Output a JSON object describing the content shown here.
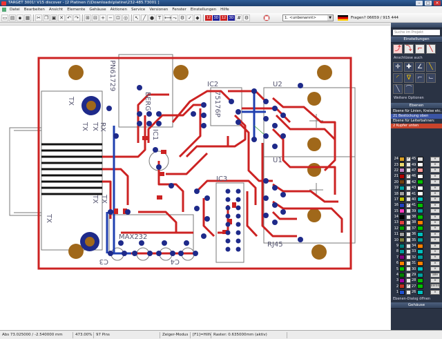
{
  "window": {
    "title": "TARGET 3001! V15 discover - [2 Platinen (\\\\Downloads\\platine\\232-485.T3001 ]"
  },
  "menu": [
    "Datei",
    "Bearbeiten",
    "Ansicht",
    "Elemente",
    "Gehäuse",
    "Aktionen",
    "Service",
    "Versionen",
    "Fenster",
    "Einstellungen",
    "Hilfe"
  ],
  "toolbar": {
    "layer_select": "1. <unbenannt>",
    "question_counter": "Fragen? 06659 / 915 444",
    "layer_tags": [
      "12",
      "3D",
      "12",
      "3D"
    ]
  },
  "board": {
    "silkscreen_labels": {
      "connector_header": "PN61729",
      "berg": "BERG",
      "tx_top": "TX",
      "tx_conn_top": "TX",
      "tx_conn_bottom": "TX",
      "rx_label": "RX",
      "tx_left": "TX",
      "tx_left2": "TX",
      "tx_bottom": "TX",
      "ic2": "IC2",
      "ic2_part": "75176P",
      "u2": "U2",
      "ic1": "IC1",
      "max232": "MAX232",
      "ic3": "IC3",
      "c3": "C3",
      "c4": "C4",
      "rj45": "RJ45",
      "u1": "U1"
    }
  },
  "sidebar": {
    "search_placeholder": "Suche im Projekt",
    "einstellungen_label": "Einstellungen",
    "anschluss_label": "Anschlüsse auch",
    "weitere_optionen": "Weitere Optionen",
    "ebenen_header": "Ebenen",
    "ebene_linien": "Ebene für Linien, Kreise etc.",
    "row_bestueckung": "21 Bestückung oben",
    "ebene_leiter": "Ebene für Leiterbahnen:",
    "row_kupfer": "2 Kupfer unten",
    "layers": [
      {
        "num": "24",
        "color": "#d8a028",
        "visible": "✓",
        "num2": "45",
        "color2": "#e0e0e0"
      },
      {
        "num": "23",
        "color": "#e8d870",
        "visible": "",
        "num2": "49",
        "color2": "#ffffff"
      },
      {
        "num": "22",
        "color": "#c080c0",
        "visible": "",
        "num2": "47",
        "color2": "#ff9999"
      },
      {
        "num": "21",
        "color": "#b00000",
        "visible": "✓",
        "num2": "46",
        "color2": "#ffffff"
      },
      {
        "num": "20",
        "color": "#704010",
        "visible": "",
        "num2": "42",
        "color2": "#00c000"
      },
      {
        "num": "19",
        "color": "#00a0a0",
        "visible": "",
        "num2": "43",
        "color2": "#ffffff"
      },
      {
        "num": "18",
        "color": "#a0a0a0",
        "visible": "",
        "num2": "41",
        "color2": "#ffffff"
      },
      {
        "num": "17",
        "color": "#c0c000",
        "visible": "",
        "num2": "40",
        "color2": "#00c0c0"
      },
      {
        "num": "16",
        "color": "#2040c0",
        "visible": "✓",
        "num2": "41",
        "color2": "#00c000"
      },
      {
        "num": "15",
        "color": "#ff40c0",
        "visible": "",
        "num2": "39",
        "color2": "#00a0a0"
      },
      {
        "num": "14",
        "color": "#000000",
        "visible": "",
        "num2": "38",
        "color2": "#00c000"
      },
      {
        "num": "13",
        "color": "#e04040",
        "visible": "",
        "num2": "38",
        "color2": "#ff8000"
      },
      {
        "num": "12",
        "color": "#00a000",
        "visible": "",
        "num2": "37",
        "color2": "#00c000"
      },
      {
        "num": "11",
        "color": "#a0a0a0",
        "visible": "",
        "num2": "36",
        "color2": "#00c0c0"
      },
      {
        "num": "10",
        "color": "#808040",
        "visible": "",
        "num2": "35",
        "color2": "#00a0a0"
      },
      {
        "num": "9",
        "color": "#008080",
        "visible": "",
        "num2": "34",
        "color2": "#ff8000"
      },
      {
        "num": "8",
        "color": "#00a0a0",
        "visible": "",
        "num2": "33",
        "color2": "#00c0c0"
      },
      {
        "num": "7",
        "color": "#800080",
        "visible": "",
        "num2": "32",
        "color2": "#00a0a0"
      },
      {
        "num": "6",
        "color": "#ff8000",
        "visible": "",
        "num2": "31",
        "color2": "#ff8000"
      },
      {
        "num": "5",
        "color": "#00c000",
        "visible": "",
        "num2": "30",
        "color2": "#00c0c0"
      },
      {
        "num": "4",
        "color": "#008000",
        "visible": "",
        "num2": "29",
        "color2": "#00a0a0"
      },
      {
        "num": "3",
        "color": "#a000a0",
        "visible": "",
        "num2": "28",
        "color2": "#00c000"
      },
      {
        "num": "2",
        "color": "#c03020",
        "visible": "✓",
        "num2": "27",
        "color2": "#00c000"
      },
      {
        "num": "1",
        "color": "#2050d0",
        "visible": "",
        "num2": "26",
        "color2": "#00c0c0"
      }
    ],
    "btn_alle": "alle",
    "btn_keine": "keine",
    "ebenen_dialog": "Ebenen-Dialog öffnen",
    "gehaeuse_header": "Gehäuse"
  },
  "status": {
    "coords": "Abs 73.025000 / -2.540000 mm",
    "zoom": "473.00%",
    "pins": "97 Pins",
    "mode": "Zeiger-Modus",
    "help": "[F1]=Hilfe",
    "raster": "Raster: 0.635000mm (aktiv)"
  },
  "colors": {
    "board": "#cc2222",
    "trace": "#cc2222",
    "via": "#1e2a8a",
    "pad_brown": "#a0681a",
    "silk": "#6a6a8a"
  }
}
